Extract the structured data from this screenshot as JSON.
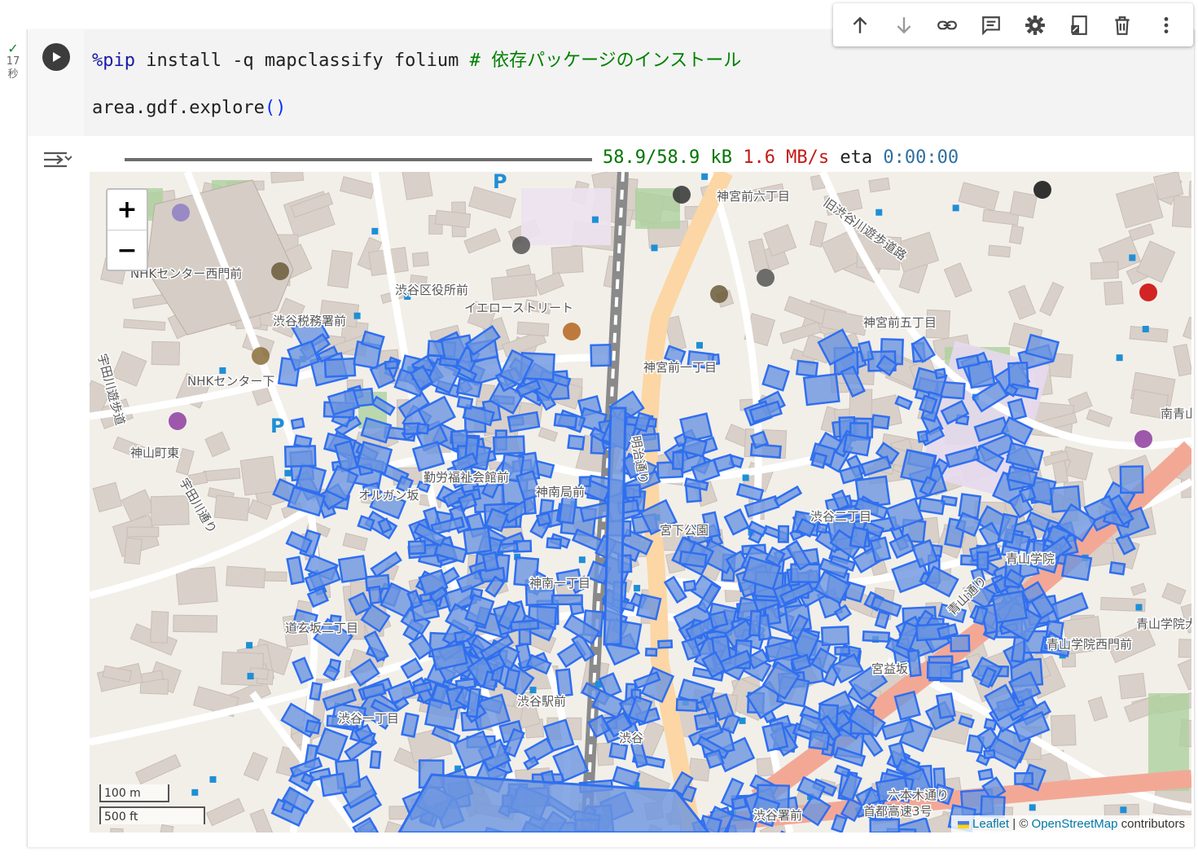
{
  "cell": {
    "status_check": "✓",
    "exec_time": "17",
    "exec_unit": "秒",
    "code_line1_magic": "%pip",
    "code_line1_cmd": " install -q mapclassify folium ",
    "code_line1_comment": "# 依存パッケージのインストール",
    "code_line2_pre": "area.gdf.explore",
    "code_line2_parens": "()"
  },
  "toolbar": {
    "items": [
      "arrow-up-icon",
      "arrow-down-icon",
      "link-icon",
      "comment-icon",
      "gear-icon",
      "mirror-cell-icon",
      "trash-icon",
      "more-vert-icon"
    ]
  },
  "output": {
    "progress_fraction": 1.0,
    "downloaded": "58.9/58.9 kB",
    "speed": "1.6 MB/s",
    "eta_label": "eta",
    "eta_value": "0:00:00"
  },
  "map": {
    "zoom_in": "+",
    "zoom_out": "−",
    "scale_metric": "100 m",
    "scale_imperial": "500 ft",
    "attribution_leaflet": "Leaflet",
    "attribution_sep": " | © ",
    "attribution_osm": "OpenStreetMap",
    "attribution_tail": " contributors",
    "polygon_fill": "#6c95e0",
    "polygon_stroke": "#2f6fef",
    "labels": [
      "神宮前六丁目",
      "旧渋谷川遊歩道路",
      "神宮前五丁目",
      "NHKセンター西門前",
      "渋谷区役所前",
      "イエローストリート",
      "渋谷税務署前",
      "NHKセンター下",
      "神山町東",
      "宇田川遊歩道",
      "宇田川通り",
      "オルガン坂",
      "勤労福祉会館前",
      "神南局前",
      "宮下公園",
      "神宮前一丁目",
      "明治通り",
      "青山学院",
      "青山通り",
      "青山学院西門前",
      "宮益坂",
      "渋谷駅前",
      "道玄坂二丁目",
      "渋谷",
      "渋谷署前",
      "首都高速3号",
      "六本木通り",
      "南青山",
      "神南一丁目",
      "渋谷二丁目",
      "渋谷一丁目",
      "青山学院大学"
    ]
  }
}
